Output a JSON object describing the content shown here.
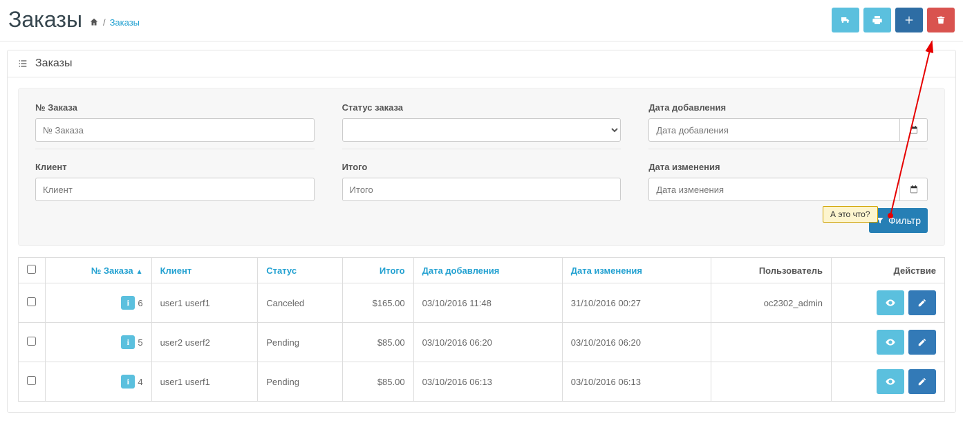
{
  "header": {
    "title": "Заказы",
    "breadcrumb_current": "Заказы"
  },
  "toolbar": {
    "ship_title": "Отправить",
    "print_title": "Печать",
    "add_title": "Добавить",
    "delete_title": "Удалить"
  },
  "panel": {
    "heading": "Заказы"
  },
  "filters": {
    "order_id_label": "№ Заказа",
    "order_id_placeholder": "№ Заказа",
    "status_label": "Статус заказа",
    "date_added_label": "Дата добавления",
    "date_added_placeholder": "Дата добавления",
    "customer_label": "Клиент",
    "customer_placeholder": "Клиент",
    "total_label": "Итого",
    "total_placeholder": "Итого",
    "date_modified_label": "Дата изменения",
    "date_modified_placeholder": "Дата изменения",
    "filter_button": "Фильтр"
  },
  "table": {
    "columns": {
      "order_id": "№ Заказа",
      "customer": "Клиент",
      "status": "Статус",
      "total": "Итого",
      "date_added": "Дата добавления",
      "date_modified": "Дата изменения",
      "user": "Пользователь",
      "action": "Действие"
    },
    "rows": [
      {
        "id": "6",
        "customer": "user1 userf1",
        "status": "Canceled",
        "total": "$165.00",
        "date_added": "03/10/2016 11:48",
        "date_modified": "31/10/2016 00:27",
        "user": "oc2302_admin"
      },
      {
        "id": "5",
        "customer": "user2 userf2",
        "status": "Pending",
        "total": "$85.00",
        "date_added": "03/10/2016 06:20",
        "date_modified": "03/10/2016 06:20",
        "user": ""
      },
      {
        "id": "4",
        "customer": "user1 userf1",
        "status": "Pending",
        "total": "$85.00",
        "date_added": "03/10/2016 06:13",
        "date_modified": "03/10/2016 06:13",
        "user": ""
      }
    ]
  },
  "annotation": {
    "text": "А это что?"
  }
}
